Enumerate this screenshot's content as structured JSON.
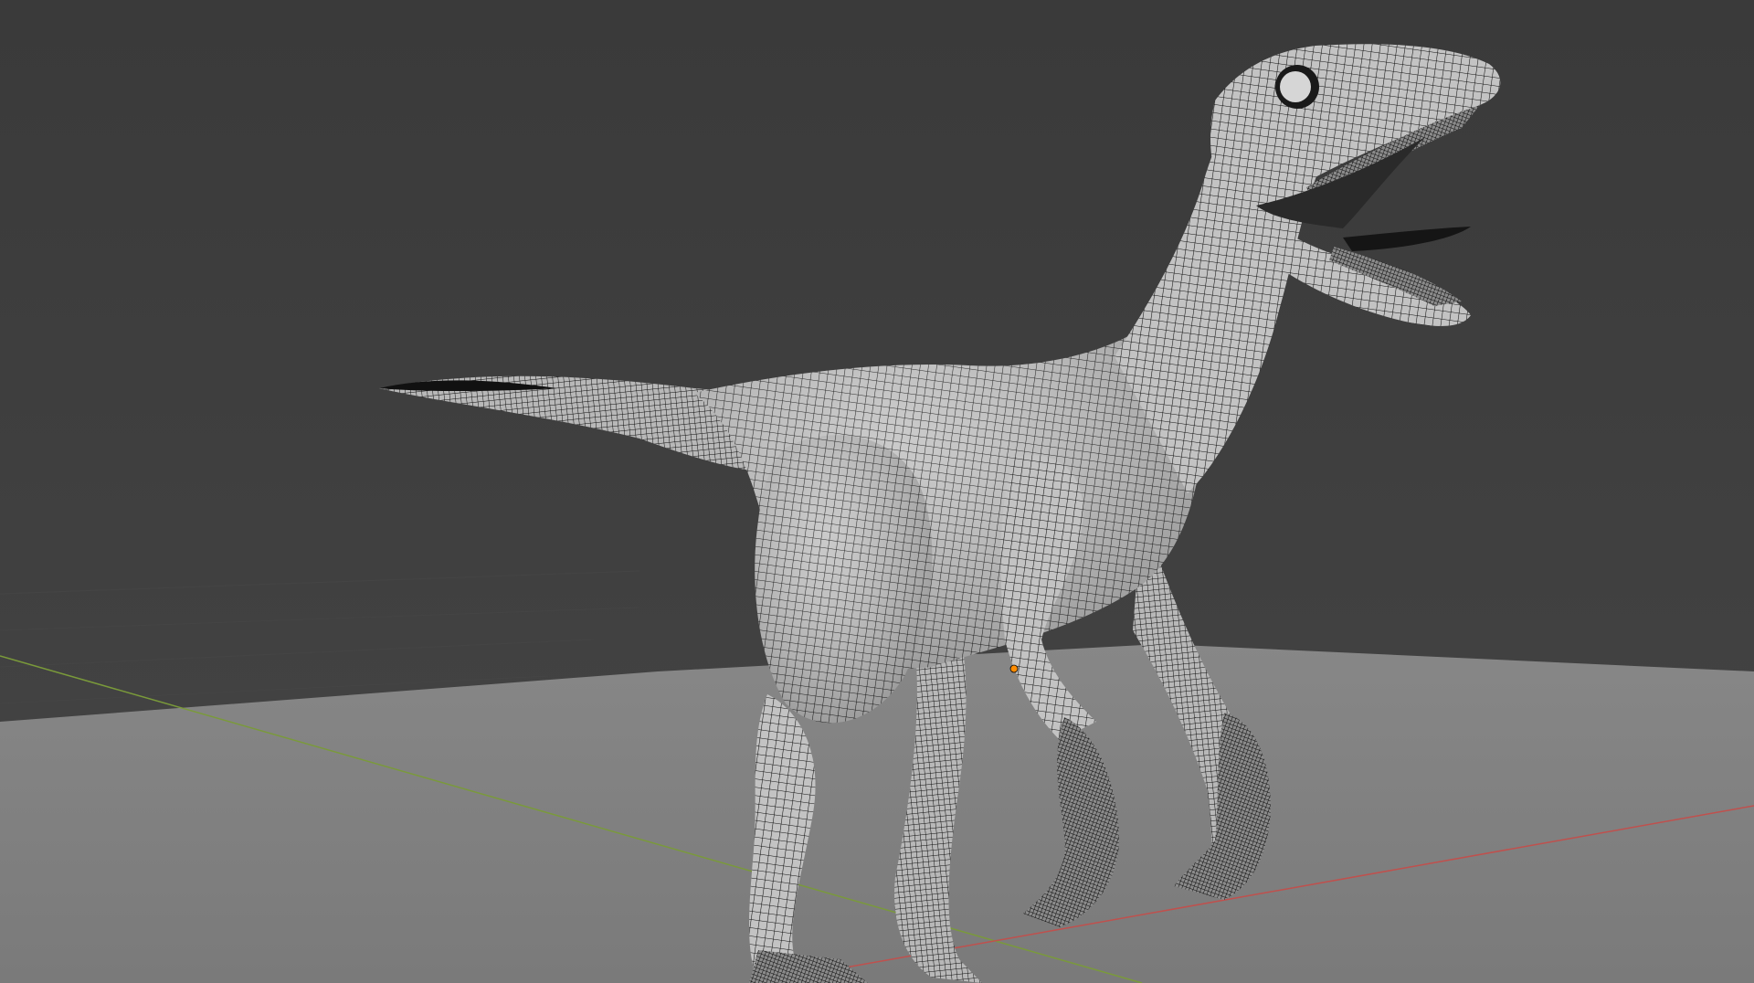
{
  "viewport": {
    "view": "perspective",
    "shading": "solid-wireframe",
    "background_color": "#3c3c3c",
    "floor_color": "#8c8c8c",
    "mesh_color": "#c4c4c4",
    "wire_color": "#111111",
    "x_axis_color": "#c0504d",
    "y_axis_color": "#7a9a3a",
    "origin_color": "#ff8c00"
  },
  "scene": {
    "object": "raptor-mesh",
    "icons": [
      "object-origin-icon"
    ]
  }
}
